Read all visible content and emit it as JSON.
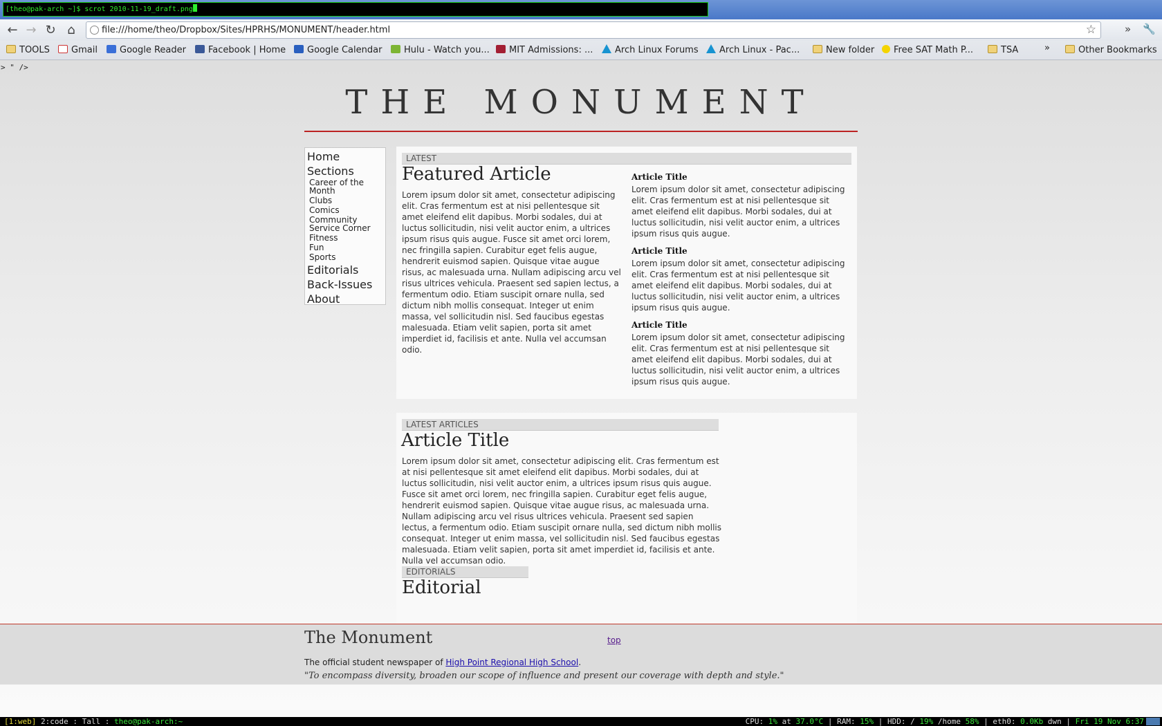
{
  "terminal": {
    "prompt": "[theo@pak-arch ~]$ scrot 2010-11-19_draft.png"
  },
  "browser": {
    "url": "file:///home/theo/Dropbox/Sites/HPRHS/MONUMENT/header.html",
    "bookmarks": [
      {
        "label": "TOOLS",
        "icon": "folder"
      },
      {
        "label": "Gmail",
        "icon": "gmail"
      },
      {
        "label": "Google Reader",
        "icon": "reader"
      },
      {
        "label": "Facebook | Home",
        "icon": "fb"
      },
      {
        "label": "Google Calendar",
        "icon": "cal"
      },
      {
        "label": "Hulu - Watch you...",
        "icon": "hulu"
      },
      {
        "label": "MIT Admissions: ...",
        "icon": "mit"
      },
      {
        "label": "Arch Linux Forums",
        "icon": "arch"
      },
      {
        "label": "Arch Linux - Pac...",
        "icon": "arch"
      },
      {
        "label": "New folder",
        "icon": "folder"
      },
      {
        "label": "Free SAT Math P...",
        "icon": "sat"
      },
      {
        "label": "TSA",
        "icon": "folder"
      }
    ],
    "more_bookmarks": "»",
    "other_bookmarks": "Other Bookmarks"
  },
  "page": {
    "stray_text": "> \" />",
    "site_title": "THE MONUMENT",
    "nav": {
      "home": "Home",
      "sections": "Sections",
      "sub": [
        "Career of the Month",
        "Clubs",
        "Comics",
        "Community Service Corner",
        "Fitness",
        "Fun",
        "Sports"
      ],
      "editorials": "Editorials",
      "back_issues": "Back-Issues",
      "about": "About"
    },
    "latest": {
      "label": "LATEST",
      "featured_title": "Featured Article",
      "featured_body": "Lorem ipsum dolor sit amet, consectetur adipiscing elit. Cras fermentum est at nisi pellentesque sit amet eleifend elit dapibus. Morbi sodales, dui at luctus sollicitudin, nisi velit auctor enim, a ultrices ipsum risus quis augue. Fusce sit amet orci lorem, nec fringilla sapien. Curabitur eget felis augue, hendrerit euismod sapien. Quisque vitae augue risus, ac malesuada urna. Nullam adipiscing arcu vel risus ultrices vehicula. Praesent sed sapien lectus, a fermentum odio. Etiam suscipit ornare nulla, sed dictum nibh mollis consequat. Integer ut enim massa, vel sollicitudin nisl. Sed faucibus egestas malesuada. Etiam velit sapien, porta sit amet imperdiet id, facilisis et ante. Nulla vel accumsan odio.",
      "side_articles": [
        {
          "title": "Article Title",
          "body": "Lorem ipsum dolor sit amet, consectetur adipiscing elit. Cras fermentum est at nisi pellentesque sit amet eleifend elit dapibus. Morbi sodales, dui at luctus sollicitudin, nisi velit auctor enim, a ultrices ipsum risus quis augue."
        },
        {
          "title": "Article Title",
          "body": "Lorem ipsum dolor sit amet, consectetur adipiscing elit. Cras fermentum est at nisi pellentesque sit amet eleifend elit dapibus. Morbi sodales, dui at luctus sollicitudin, nisi velit auctor enim, a ultrices ipsum risus quis augue."
        },
        {
          "title": "Article Title",
          "body": "Lorem ipsum dolor sit amet, consectetur adipiscing elit. Cras fermentum est at nisi pellentesque sit amet eleifend elit dapibus. Morbi sodales, dui at luctus sollicitudin, nisi velit auctor enim, a ultrices ipsum risus quis augue."
        }
      ]
    },
    "latest_articles": {
      "label": "LATEST ARTICLES",
      "title": "Article Title",
      "body": "Lorem ipsum dolor sit amet, consectetur adipiscing elit. Cras fermentum est at nisi pellentesque sit amet eleifend elit dapibus. Morbi sodales, dui at luctus sollicitudin, nisi velit auctor enim, a ultrices ipsum risus quis augue. Fusce sit amet orci lorem, nec fringilla sapien. Curabitur eget felis augue, hendrerit euismod sapien. Quisque vitae augue risus, ac malesuada urna. Nullam adipiscing arcu vel risus ultrices vehicula. Praesent sed sapien lectus, a fermentum odio. Etiam suscipit ornare nulla, sed dictum nibh mollis consequat. Integer ut enim massa, vel sollicitudin nisl. Sed faucibus egestas malesuada. Etiam velit sapien, porta sit amet imperdiet id, facilisis et ante. Nulla vel accumsan odio."
    },
    "editorials": {
      "label": "EDITORIALS",
      "title": "Editorial"
    },
    "footer": {
      "title": "The Monument",
      "top_link": "top",
      "line_prefix": "The official student newspaper of ",
      "school_link": "High Point Regional High School",
      "line_suffix": ".",
      "quote": "\"To encompass diversity, broaden our scope of influence and present our coverage with depth and style.\""
    }
  },
  "statusbar": {
    "tag_active": "[1:web]",
    "tag_other": "2:code : Tall :",
    "user_host": "theo@pak-arch:~",
    "cpu_label": "CPU:",
    "cpu_value": "1%",
    "cpu_at": "at",
    "cpu_temp": "37.0°C",
    "ram_label": "RAM:",
    "ram_value": "15%",
    "hdd_label": "HDD: /",
    "hdd_root": "19%",
    "hdd_home_label": "/home",
    "hdd_home": "58%",
    "net_label": "eth0:",
    "net_value": "0.0Kb",
    "net_dir": "dwn",
    "datetime": "Fri 19 Nov  6:37"
  },
  "colors": {
    "accent_rule": "#b22222",
    "terminal_green": "#2df02d"
  }
}
